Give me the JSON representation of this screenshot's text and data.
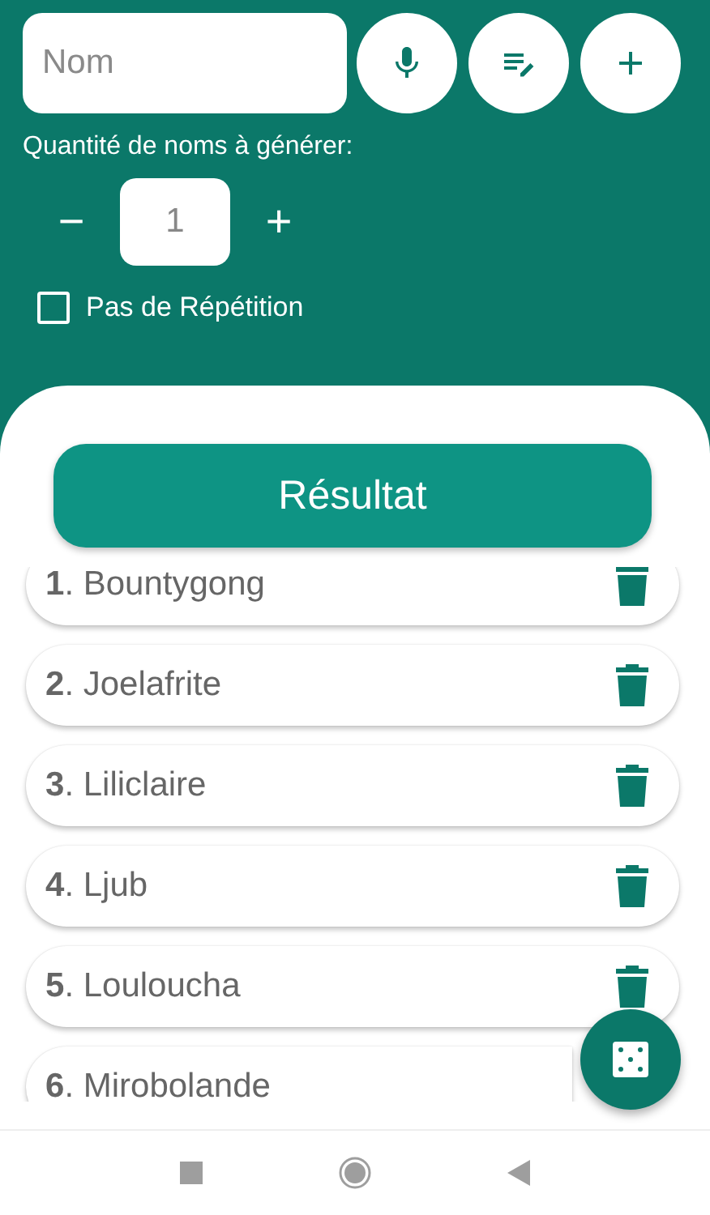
{
  "name_field": {
    "placeholder": "Nom"
  },
  "quantity": {
    "label": "Quantité de noms à générer:",
    "decrement": "−",
    "value": "1",
    "increment": "+"
  },
  "no_repeat": {
    "label": "Pas de Répétition",
    "checked": false
  },
  "result_button": "Résultat",
  "results": [
    {
      "text": "**1**. Bountygong",
      "deletable": true
    },
    {
      "text": "**2**. Joelafrite",
      "deletable": true
    },
    {
      "text": "**3**. Liliclaire",
      "deletable": true
    },
    {
      "text": "**4**. Ljub",
      "deletable": true
    },
    {
      "text": "**5**. Louloucha",
      "deletable": true
    },
    {
      "text": "**6**. Mirobolande"
    }
  ]
}
